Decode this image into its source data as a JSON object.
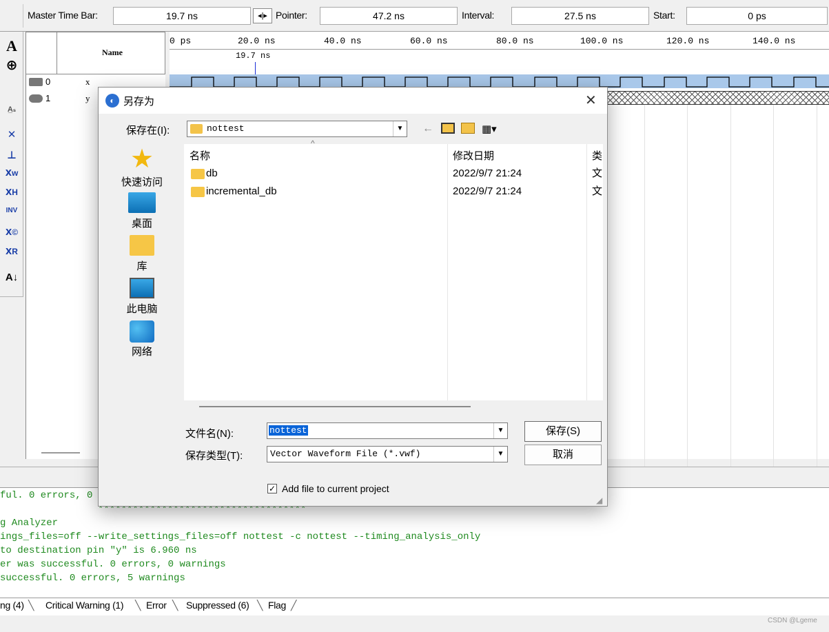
{
  "timebar": {
    "master_label": "Master Time Bar:",
    "master_value": "19.7 ns",
    "pointer_label": "Pointer:",
    "pointer_value": "47.2 ns",
    "interval_label": "Interval:",
    "interval_value": "27.5 ns",
    "start_label": "Start:",
    "start_value": "0 ps"
  },
  "toolbar": {
    "icons": [
      "text-tool-icon",
      "zoom-icon",
      "waveform-tool-icon",
      "forcing-unknown-icon",
      "forcing-low-icon",
      "forcing-weak-icon",
      "forcing-high-icon",
      "invert-icon",
      "count-value-icon",
      "random-value-icon",
      "sort-icon"
    ]
  },
  "waveform": {
    "name_header": "Name",
    "signals": [
      {
        "index": "0",
        "name": "x"
      },
      {
        "index": "1",
        "name": "y"
      }
    ],
    "ticks": [
      "0 ps",
      "20.0 ns",
      "40.0 ns",
      "60.0 ns",
      "80.0 ns",
      "100.0 ns",
      "120.0 ns",
      "140.0 ns"
    ],
    "master_marker": "19.7 ns"
  },
  "dialog": {
    "title": "另存为",
    "save_in_label": "保存在(I):",
    "save_in_value": "nottest",
    "places": [
      {
        "label": "快速访问",
        "icon": "star-icon"
      },
      {
        "label": "桌面",
        "icon": "desktop-icon"
      },
      {
        "label": "库",
        "icon": "folder-icon"
      },
      {
        "label": "此电脑",
        "icon": "computer-icon"
      },
      {
        "label": "网络",
        "icon": "network-icon"
      }
    ],
    "columns": {
      "name": "名称",
      "modified": "修改日期",
      "type": "类"
    },
    "files": [
      {
        "name": "db",
        "modified": "2022/9/7 21:24",
        "type": "文"
      },
      {
        "name": "incremental_db",
        "modified": "2022/9/7 21:24",
        "type": "文"
      }
    ],
    "filename_label": "文件名(N):",
    "filename_value": "nottest",
    "filetype_label": "保存类型(T):",
    "filetype_value": "Vector Waveform File (*.vwf)",
    "save_button": "保存(S)",
    "cancel_button": "取消",
    "add_file_label": "Add file to current project",
    "add_file_checked": true
  },
  "log": {
    "lines": [
      "ful. 0 errors, 0",
      "************************************",
      "g Analyzer",
      "ings_files=off --write_settings_files=off nottest -c nottest --timing_analysis_only",
      "to destination pin \"y\" is 6.960 ns",
      "er was successful. 0 errors, 0 warnings",
      "successful. 0 errors, 5 warnings"
    ]
  },
  "tabs": [
    "ng (4)",
    "Critical Warning (1)",
    "Error",
    "Suppressed (6)",
    "Flag"
  ],
  "watermark": "CSDN @Lgeme",
  "colors": {
    "wave_fill": "#a9c8ea",
    "log_text": "#1f8a1f",
    "selection": "#0a64d8"
  }
}
